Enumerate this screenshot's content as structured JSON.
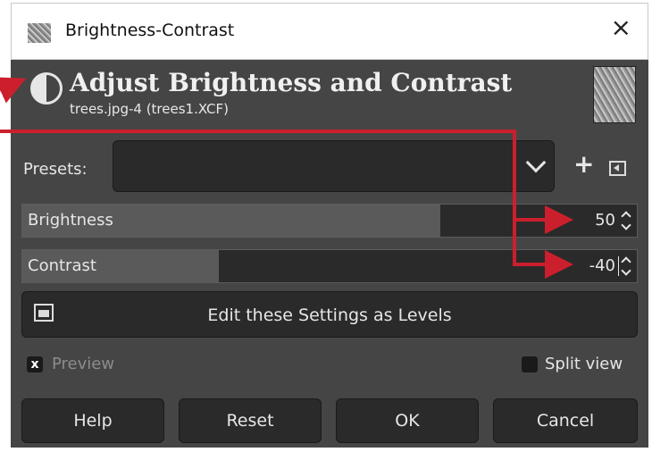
{
  "window": {
    "title": "Brightness-Contrast",
    "close_glyph": "×"
  },
  "header": {
    "title": "Adjust Brightness and Contrast",
    "subtitle": "trees.jpg-4 (trees1.XCF)"
  },
  "presets": {
    "label": "Presets:",
    "value": ""
  },
  "sliders": [
    {
      "label": "Brightness",
      "value": "50",
      "fill_fraction": 0.68
    },
    {
      "label": "Contrast",
      "value": "-40",
      "fill_fraction": 0.32
    }
  ],
  "levels_button": {
    "label": "Edit these Settings as Levels"
  },
  "preview": {
    "label": "Preview",
    "checked": true,
    "check_glyph": "x"
  },
  "split_view": {
    "label": "Split view",
    "checked": false
  },
  "buttons": {
    "help": "Help",
    "reset": "Reset",
    "ok": "OK",
    "cancel": "Cancel"
  },
  "icons": [
    "brightness-contrast-icon",
    "image-thumbnail",
    "chevron-down-icon",
    "plus-icon",
    "panel-icon",
    "levels-icon",
    "spin-arrows-icon"
  ],
  "colors": {
    "dialog_bg": "#454545",
    "field_bg": "#2a2a2a",
    "text": "#e6e6e6",
    "annotation": "#cc1f2d"
  }
}
